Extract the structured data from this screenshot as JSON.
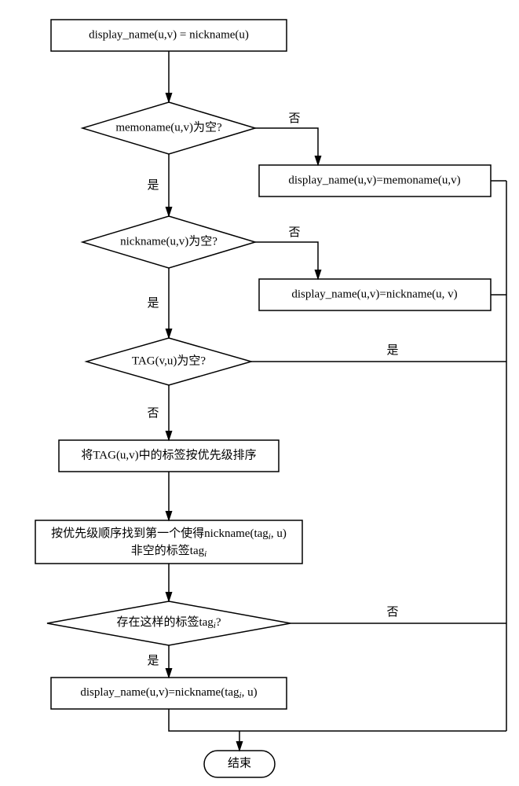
{
  "nodes": {
    "start": "display_name(u,v) = nickname(u)",
    "d1": "memoname(u,v)为空?",
    "p1": "display_name(u,v)=memoname(u,v)",
    "d2": "nickname(u,v)为空?",
    "p2": "display_name(u,v)=nickname(u, v)",
    "d3": "TAG(v,u)为空?",
    "p3": "将TAG(u,v)中的标签按优先级排序",
    "p4a": "按优先级顺序找到第一个使得nickname(tag",
    "p4b": ", u)",
    "p4c": "非空的标签tag",
    "d4a": "存在这样的标签tag",
    "d4b": "?",
    "p5a": "display_name(u,v)=nickname(tag",
    "p5b": ", u)",
    "end": "结束",
    "sub_i": "i"
  },
  "labels": {
    "yes": "是",
    "no": "否"
  }
}
